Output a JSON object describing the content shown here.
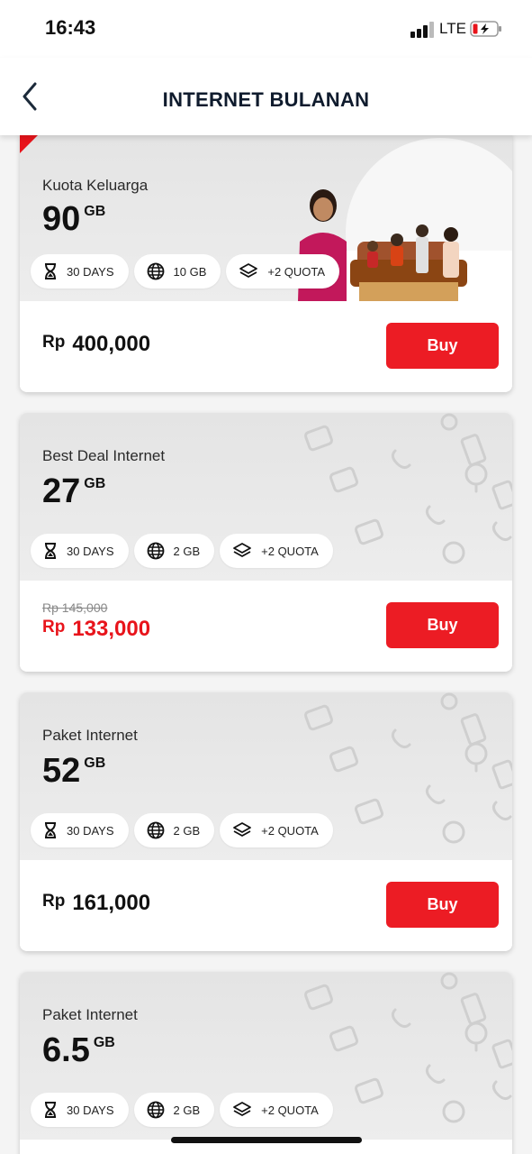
{
  "status_bar": {
    "time": "16:43",
    "network": "LTE"
  },
  "header": {
    "title": "INTERNET BULANAN"
  },
  "cards": [
    {
      "name": "Kuota Keluarga",
      "size": "90",
      "unit": "GB",
      "pills": [
        {
          "icon": "hourglass-icon",
          "label": "30 DAYS"
        },
        {
          "icon": "globe-icon",
          "label": "10 GB"
        },
        {
          "icon": "layers-icon",
          "label": "+2 QUOTA"
        }
      ],
      "currency": "Rp",
      "price": "400,000",
      "old_price": "",
      "buy_label": "Buy"
    },
    {
      "name": "Best Deal Internet",
      "size": "27",
      "unit": "GB",
      "pills": [
        {
          "icon": "hourglass-icon",
          "label": "30 DAYS"
        },
        {
          "icon": "globe-icon",
          "label": "2 GB"
        },
        {
          "icon": "layers-icon",
          "label": "+2 QUOTA"
        }
      ],
      "currency": "Rp",
      "price": "133,000",
      "old_price": "Rp 145,000",
      "buy_label": "Buy"
    },
    {
      "name": "Paket Internet",
      "size": "52",
      "unit": "GB",
      "pills": [
        {
          "icon": "hourglass-icon",
          "label": "30 DAYS"
        },
        {
          "icon": "globe-icon",
          "label": "2 GB"
        },
        {
          "icon": "layers-icon",
          "label": "+2 QUOTA"
        }
      ],
      "currency": "Rp",
      "price": "161,000",
      "old_price": "",
      "buy_label": "Buy"
    },
    {
      "name": "Paket Internet",
      "size": "6.5",
      "unit": "GB",
      "pills": [
        {
          "icon": "hourglass-icon",
          "label": "30 DAYS"
        },
        {
          "icon": "globe-icon",
          "label": "2 GB"
        },
        {
          "icon": "layers-icon",
          "label": "+2 QUOTA"
        }
      ]
    }
  ],
  "colors": {
    "accent": "#ec1c24",
    "title": "#0f1b2d",
    "sale": "#e8141b"
  }
}
